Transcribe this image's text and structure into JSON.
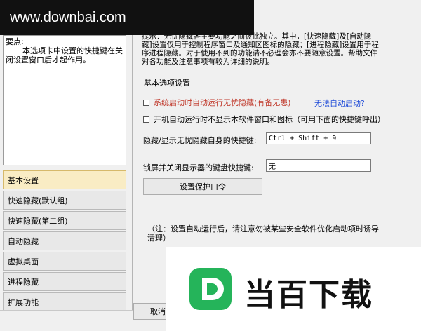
{
  "watermark": {
    "site": "www.downbai.com",
    "brand": "当百下载"
  },
  "tips": {
    "title": "要点:",
    "body": "本选项卡中设置的快捷键在关闭设置窗口后才起作用。"
  },
  "nav": [
    {
      "label": "基本设置",
      "active": true
    },
    {
      "label": "快速隐藏(默认组)",
      "active": false
    },
    {
      "label": "快速隐藏(第二组)",
      "active": false
    },
    {
      "label": "自动隐藏",
      "active": false
    },
    {
      "label": "虚拟桌面",
      "active": false
    },
    {
      "label": "进程隐藏",
      "active": false
    },
    {
      "label": "扩展功能",
      "active": false
    }
  ],
  "hint": "提示：无忧隐藏各主要功能之间彼此独立。其中，[快速隐藏]及[自动隐藏]设置仅用于控制程序窗口及通知区图标的隐藏；[进程隐藏]设置用于程序进程隐藏。对于使用不到的功能请不必理会亦不要随意设置。帮助文件对各功能及注意事项有较为详细的说明。",
  "group": {
    "title": "基本选项设置",
    "autostart_label": "系统启动时自动运行无忧隐藏(有备无患)",
    "autostart_link": "无法自动启动?",
    "hide_window_label": "开机自动运行时不显示本软件窗口和图标（可用下面的快捷键呼出）",
    "hotkey_label": "隐藏/显示无忧隐藏自身的快捷键:",
    "hotkey_value": "Ctrl + Shift + 9",
    "lock_label": "锁屏并关闭显示器的键盘快捷键:",
    "lock_value": "无",
    "password_button": "设置保护口令"
  },
  "note": "（注：设置自动运行后，请注意勿被某些安全软件优化启动项时诱导清理）",
  "bottom": {
    "cancel_label": "取消"
  },
  "colors": {
    "nav_active": "#f9ecc4",
    "link": "#1f4bd8",
    "warn_text": "#c0392b",
    "logo": "#25b45a"
  }
}
